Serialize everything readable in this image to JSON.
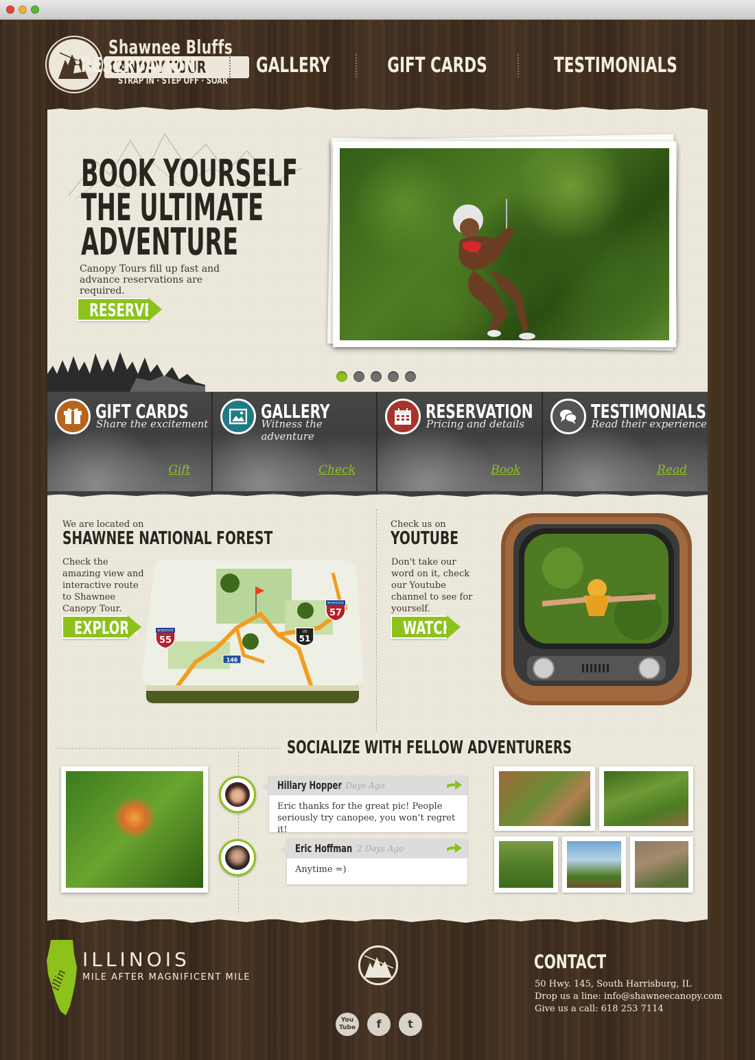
{
  "header": {
    "logo_line1": "Shawnee Bluffs",
    "logo_line2": "CANOPY TOUR",
    "logo_tagline": "STRAP IN · STEP OFF · SOAR",
    "nav": [
      "RESERVATION",
      "GALLERY",
      "GIFT CARDS",
      "TESTIMONIALS"
    ]
  },
  "hero": {
    "title_lines": [
      "BOOK YOURSELF",
      "THE ULTIMATE",
      "ADVENTURE"
    ],
    "text": "Canopy Tours fill up fast and advance reservations are required.",
    "button": "RESERVE",
    "slides": 5,
    "active_slide": 1
  },
  "features": [
    {
      "title": "GIFT CARDS",
      "subtitle": "Share the excitement",
      "link": "Gift",
      "icon": "gift-icon",
      "color": "#b5651d"
    },
    {
      "title": "GALLERY",
      "subtitle": "Witness the adventure",
      "link": "Check",
      "icon": "picture-icon",
      "color": "#1f7a86"
    },
    {
      "title": "RESERVATION",
      "subtitle": "Pricing and details",
      "link": "Book",
      "icon": "calendar-icon",
      "color": "#a8322d"
    },
    {
      "title": "TESTIMONIALS",
      "subtitle": "Read their experience",
      "link": "Read",
      "icon": "speech-bubbles-icon",
      "color": "#555555"
    }
  ],
  "location": {
    "small": "We are located on",
    "big": "SHAWNEE NATIONAL FOREST",
    "text": "Check the amazing view and interactive route to Shawnee Canopy Tour.",
    "button": "EXPLORE"
  },
  "youtube": {
    "small": "Check us on",
    "big": "YOUTUBE",
    "text": "Don't take our word on it, check our Youtube channel to see for yourself.",
    "button": "WATCH"
  },
  "map_labels": {
    "interstate_55": "55",
    "interstate_57": "57",
    "us_51": "51",
    "route_146": "146",
    "label_interstate": "INTERSTATE",
    "label_us": "US"
  },
  "social": {
    "title": "SOCIALIZE WITH FELLOW ADVENTURERS",
    "comments": [
      {
        "name": "Hillary Hopper",
        "time": "2 Days Ago",
        "text": "Eric thanks for the great pic! People seriously try canopee, you won’t regret it!"
      },
      {
        "name": "Eric Hoffman",
        "time": "2 Days Ago",
        "text": "Anytime =)"
      }
    ]
  },
  "footer": {
    "state_script": "illin",
    "state_title": "ILLINOIS",
    "state_sub": "MILE AFTER MAGNIFICENT MILE",
    "contact_title": "CONTACT",
    "contact_lines": [
      "50 Hwy. 145, South Harrisburg, IL",
      "Drop us a line: info@shawneecanopy.com",
      "Give us a call: 618 253 7114"
    ],
    "social_icons": [
      {
        "name": "youtube-icon",
        "text": "You Tube"
      },
      {
        "name": "facebook-icon",
        "text": "f"
      },
      {
        "name": "twitter-icon",
        "text": "t"
      }
    ]
  },
  "colors": {
    "accent": "#8cc21b",
    "wood": "#3d2c20",
    "paper": "#ece8dc"
  }
}
